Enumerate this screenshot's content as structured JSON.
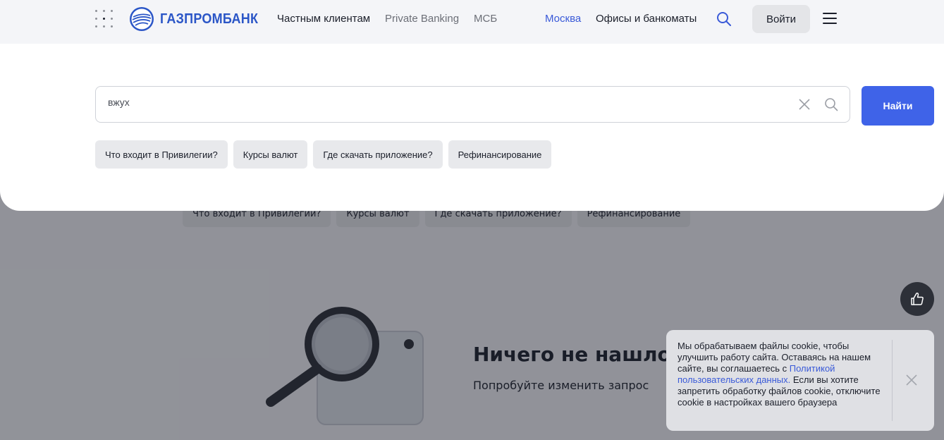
{
  "header": {
    "brand": "ГАЗПРОМБАНК",
    "nav": [
      "Частным клиентам",
      "Private Banking",
      "МСБ"
    ],
    "city": "Москва",
    "offices": "Офисы и банкоматы",
    "login": "Войти"
  },
  "search": {
    "value": "вжух",
    "find_label": "Найти",
    "suggestions": [
      "Что входит в Привилегии?",
      "Курсы валют",
      "Где скачать приложение?",
      "Рефинансирование"
    ]
  },
  "background": {
    "suggestions": [
      "Что входит в Привилегии?",
      "Курсы валют",
      "Где скачать приложение?",
      "Рефинансирование"
    ],
    "empty_title": "Ничего не нашлось",
    "empty_subtitle": "Попробуйте изменить запрос"
  },
  "cookie": {
    "text_before": "Мы обрабатываем файлы cookie, чтобы улучшить работу сайта. Оставаясь на нашем сайте, вы соглашаетесь с ",
    "link": "Политикой пользовательских данных.",
    "text_after": " Если вы хотите запретить обработку файлов cookie, отключите cookie в настройках вашего браузера"
  },
  "colors": {
    "brand_blue": "#3f63e8",
    "logo_blue": "#2b56c7",
    "city_blue": "#3a5ad8"
  }
}
